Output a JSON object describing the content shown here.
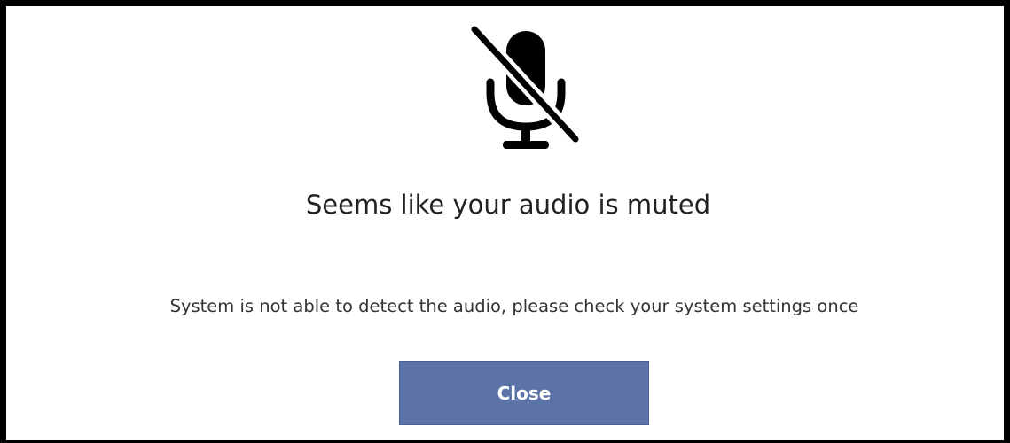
{
  "dialog": {
    "icon": "microphone-muted-icon",
    "title": "Seems like your audio is muted",
    "message": "System is not able to detect the audio, please check your system settings once",
    "close_label": "Close"
  },
  "colors": {
    "button_background": "#5b73a6",
    "button_text": "#ffffff",
    "border": "#000000"
  }
}
